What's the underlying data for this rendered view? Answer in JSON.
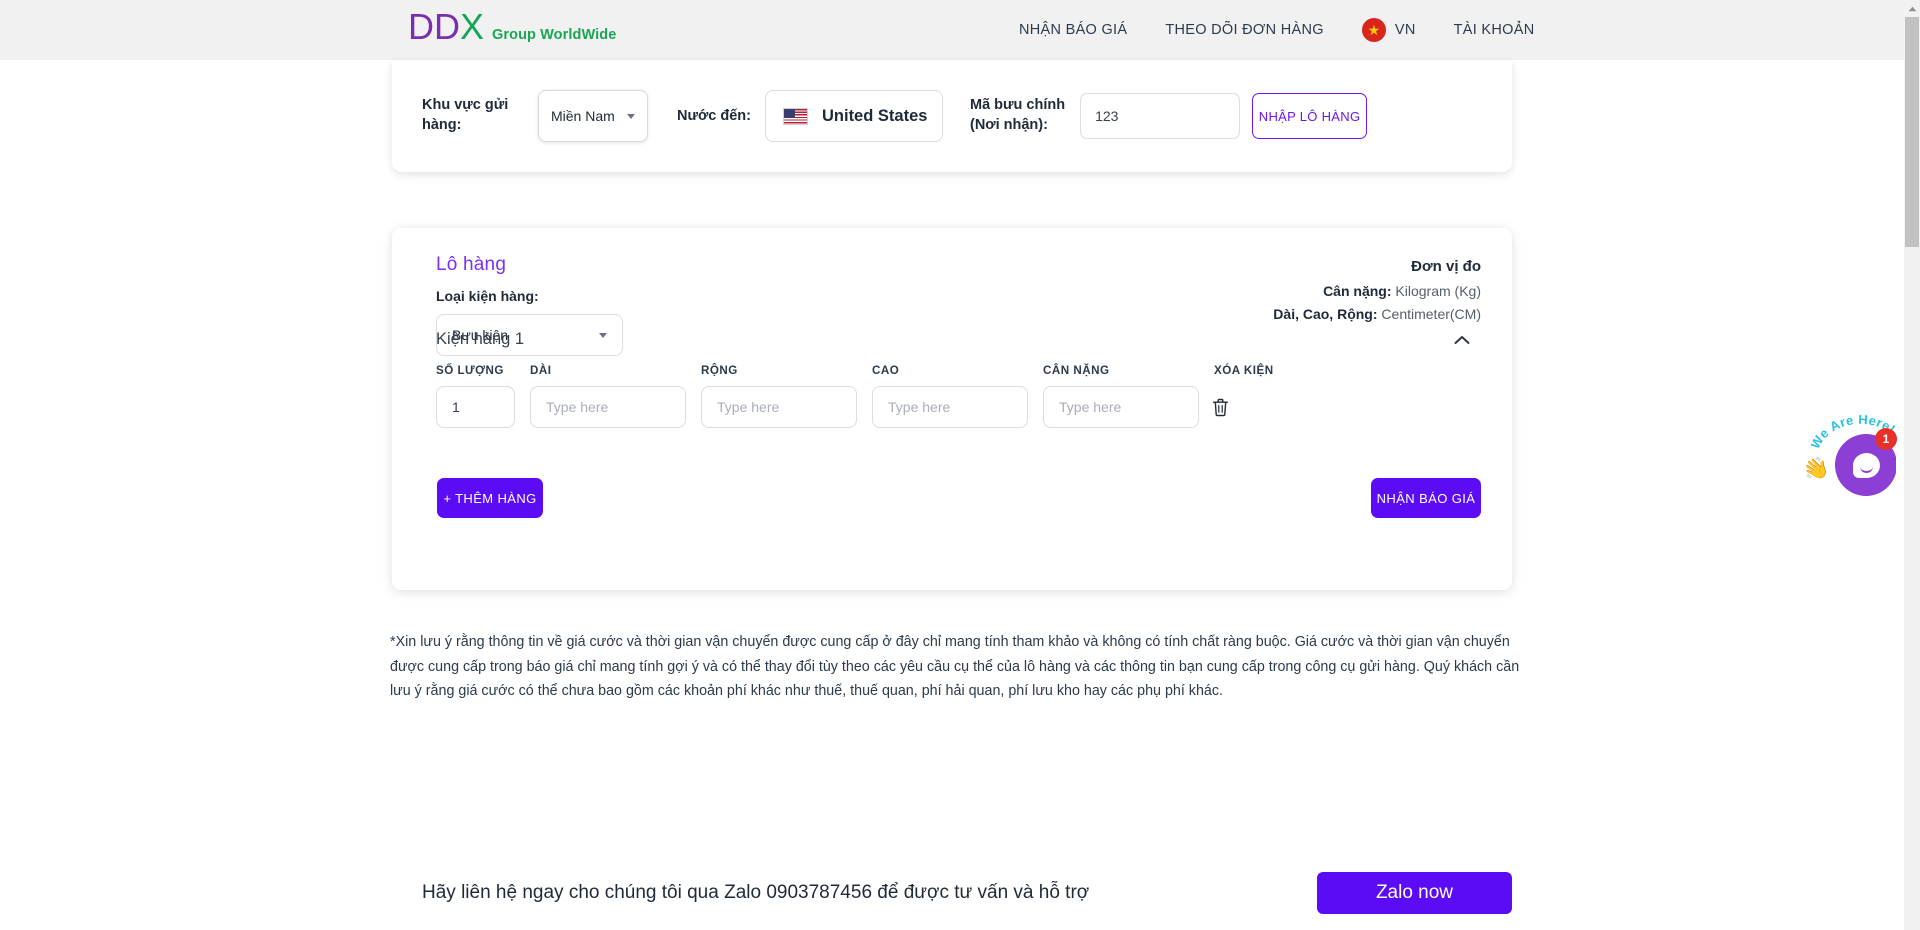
{
  "header": {
    "logo": {
      "main_d1": "D",
      "main_d2": "D",
      "main_x": "X",
      "tagline": "Group WorldWide"
    },
    "nav": [
      {
        "label": "NHẬN BÁO GIÁ",
        "name": "nav-item-quote"
      },
      {
        "label": "THEO DÕI ĐƠN HÀNG",
        "name": "nav-item-tracking"
      },
      {
        "label": "TÀI KHOẢN",
        "name": "nav-item-account"
      }
    ],
    "language": {
      "label": "VN",
      "flag": "vn-flag-icon",
      "star": "★"
    }
  },
  "filter_bar": {
    "region_label": "Khu vực gửi hàng:",
    "region_value": "Miền Nam",
    "country_label": "Nước đến:",
    "country_value": "United States",
    "country_flag": "us-flag-icon",
    "postal_label": "Mã bưu chính (Nơi nhận):",
    "postal_value": "123",
    "postal_placeholder": "",
    "import_button": "NHẬP LÔ HÀNG"
  },
  "shipment_card": {
    "title": "Lô hàng",
    "package_type_label": "Loại kiện hàng:",
    "package_type_value": "Bưu kiện",
    "units": {
      "title": "Đơn vị đo",
      "weight_label": "Cân nặng:",
      "weight_value": "Kilogram (Kg)",
      "dims_label": "Dài, Cao, Rộng:",
      "dims_value": "Centimeter(CM)"
    },
    "package_row_title": "Kiện hàng 1",
    "columns": [
      {
        "label": "SỐ LƯỢNG",
        "name": "column-quantity"
      },
      {
        "label": "DÀI",
        "name": "column-length"
      },
      {
        "label": "RỘNG",
        "name": "column-width"
      },
      {
        "label": "CAO",
        "name": "column-height"
      },
      {
        "label": "CÂN NẶNG",
        "name": "column-weight"
      },
      {
        "label": "XÓA KIỆN",
        "name": "column-delete"
      }
    ],
    "fields": {
      "quantity_value": "1",
      "length_value": "",
      "length_placeholder": "Type here",
      "width_value": "",
      "width_placeholder": "Type here",
      "height_value": "",
      "height_placeholder": "Type here",
      "weight_value": "",
      "weight_placeholder": "Type here"
    },
    "add_button": "+ THÊM HÀNG",
    "quote_button": "NHẬN BÁO GIÁ"
  },
  "disclaimer": "*Xin lưu ý rằng thông tin về giá cước và thời gian vận chuyển được cung cấp ở đây chỉ mang tính tham khảo và không có tính chất ràng buộc. Giá cước và thời gian vận chuyển được cung cấp trong báo giá chỉ mang tính gợi ý và có thể thay đổi tùy theo các yêu cầu cụ thể của lô hàng và các thông tin bạn cung cấp trong công cụ gửi hàng. Quý khách cần lưu ý rằng giá cước có thể chưa bao gồm các khoản phí khác như thuế, thuế quan, phí hải quan, phí lưu kho hay các phụ phí khác.",
  "zalo": {
    "text": "Hãy liên hệ ngay cho chúng tôi qua Zalo 0903787456 để được tư vấn và hỗ trợ",
    "button": "Zalo now"
  },
  "chat_widget": {
    "label": "We Are Here!",
    "badge": "1",
    "hand": "👋"
  },
  "colors": {
    "brand_purple": "#7b2ff7",
    "button_purple": "#5b0cf5",
    "outline_purple": "#6c17f0",
    "logo_green": "#18a558",
    "logo_violet": "#7a2fb0",
    "flag_red": "#da251d",
    "badge_red": "#e8302a"
  }
}
